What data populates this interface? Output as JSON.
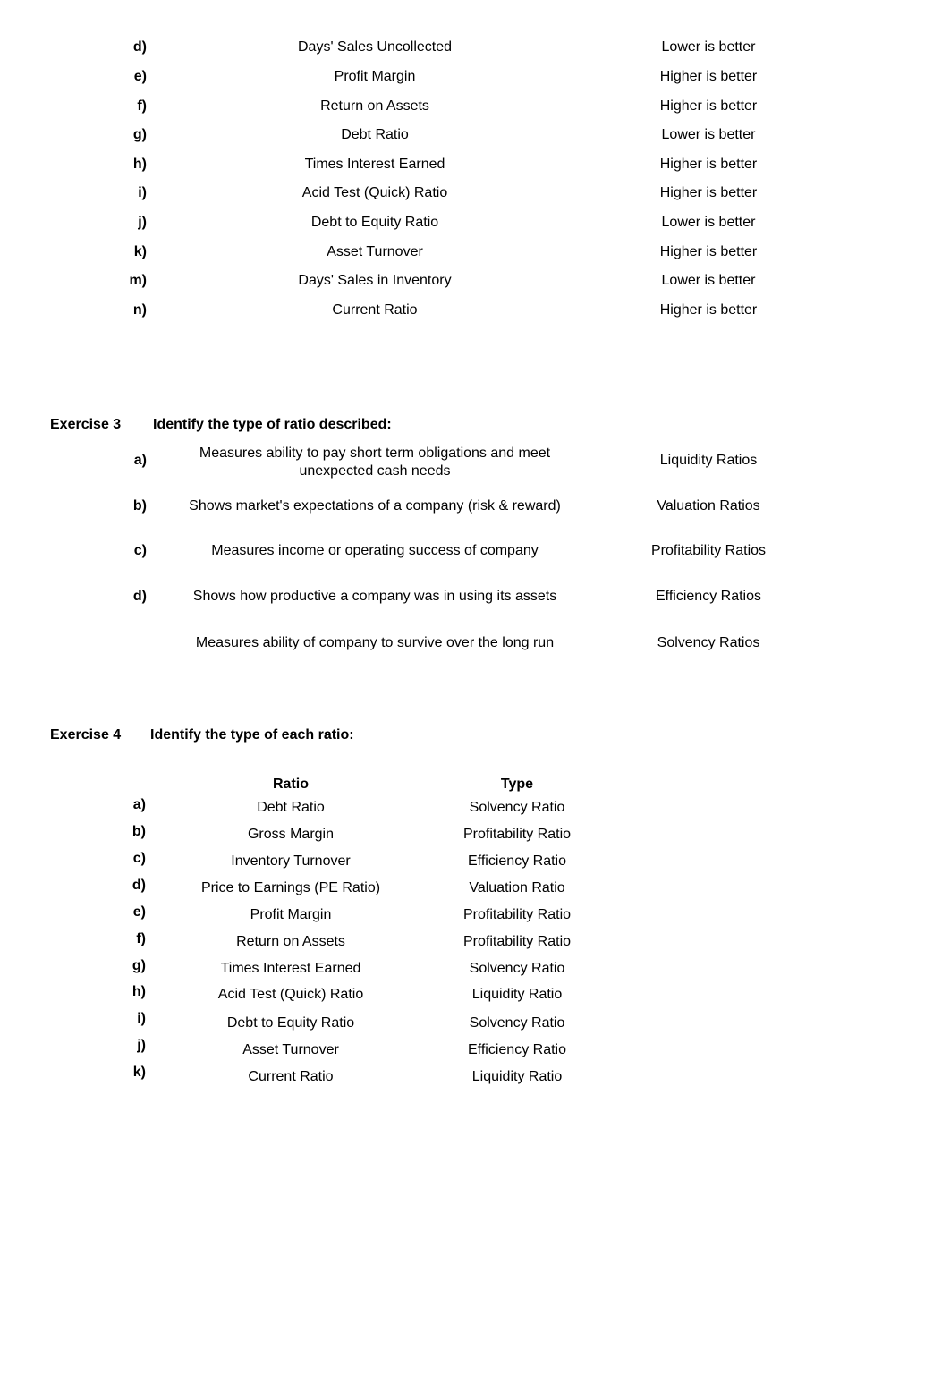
{
  "exercise2": {
    "rows": [
      {
        "label": "d)",
        "ratio": "Days' Sales Uncollected",
        "direction": "Lower is better"
      },
      {
        "label": "e)",
        "ratio": "Profit Margin",
        "direction": "Higher is better"
      },
      {
        "label": "f)",
        "ratio": "Return on Assets",
        "direction": "Higher is better"
      },
      {
        "label": "g)",
        "ratio": "Debt Ratio",
        "direction": "Lower is better"
      },
      {
        "label": "h)",
        "ratio": "Times Interest Earned",
        "direction": "Higher is better"
      },
      {
        "label": "i)",
        "ratio": "Acid Test (Quick) Ratio",
        "direction": "Higher is better"
      },
      {
        "label": "j)",
        "ratio": "Debt to Equity Ratio",
        "direction": "Lower is better"
      },
      {
        "label": "k)",
        "ratio": "Asset Turnover",
        "direction": "Higher is better"
      },
      {
        "label": "m)",
        "ratio": "Days' Sales in Inventory",
        "direction": "Lower is better"
      },
      {
        "label": "n)",
        "ratio": "Current Ratio",
        "direction": "Higher is better"
      }
    ]
  },
  "exercise3": {
    "title": "Exercise 3",
    "instruction": "Identify the type of ratio described:",
    "rows": [
      {
        "label": "a)",
        "description": "Measures ability to pay short term obligations and meet unexpected cash needs",
        "answer": "Liquidity Ratios"
      },
      {
        "label": "b)",
        "description": "Shows market's expectations of a company (risk & reward)",
        "answer": "Valuation Ratios"
      },
      {
        "label": "c)",
        "description": "Measures income or operating success of company",
        "answer": "Profitability Ratios"
      },
      {
        "label": "d)",
        "description": "Shows how productive a company was in using its assets",
        "answer": "Efficiency Ratios"
      },
      {
        "label": "",
        "description": "Measures ability of company to survive over the long run",
        "answer": "Solvency Ratios"
      }
    ]
  },
  "exercise4": {
    "title": "Exercise 4",
    "instruction": "Identify the type of each ratio:",
    "headers": {
      "ratio": "Ratio",
      "type": "Type"
    },
    "rows": [
      {
        "label": "a)",
        "ratio": "Debt Ratio",
        "type": "Solvency Ratio"
      },
      {
        "label": "b)",
        "ratio": "Gross Margin",
        "type": "Profitability Ratio"
      },
      {
        "label": "c)",
        "ratio": "Inventory Turnover",
        "type": "Efficiency Ratio"
      },
      {
        "label": "d)",
        "ratio": "Price to Earnings (PE Ratio)",
        "type": "Valuation Ratio"
      },
      {
        "label": "e)",
        "ratio": "Profit Margin",
        "type": "Profitability Ratio"
      },
      {
        "label": "f)",
        "ratio": "Return on Assets",
        "type": "Profitability Ratio"
      },
      {
        "label": "g)",
        "ratio": "Times Interest Earned",
        "type": "Solvency Ratio"
      },
      {
        "label": "h)",
        "ratio": "Acid Test (Quick) Ratio",
        "type": "Liquidity Ratio"
      },
      {
        "label": "i)",
        "ratio": "Debt to Equity Ratio",
        "type": "Solvency Ratio"
      },
      {
        "label": "j)",
        "ratio": "Asset Turnover",
        "type": "Efficiency Ratio"
      },
      {
        "label": "k)",
        "ratio": "Current Ratio",
        "type": "Liquidity Ratio"
      }
    ]
  }
}
